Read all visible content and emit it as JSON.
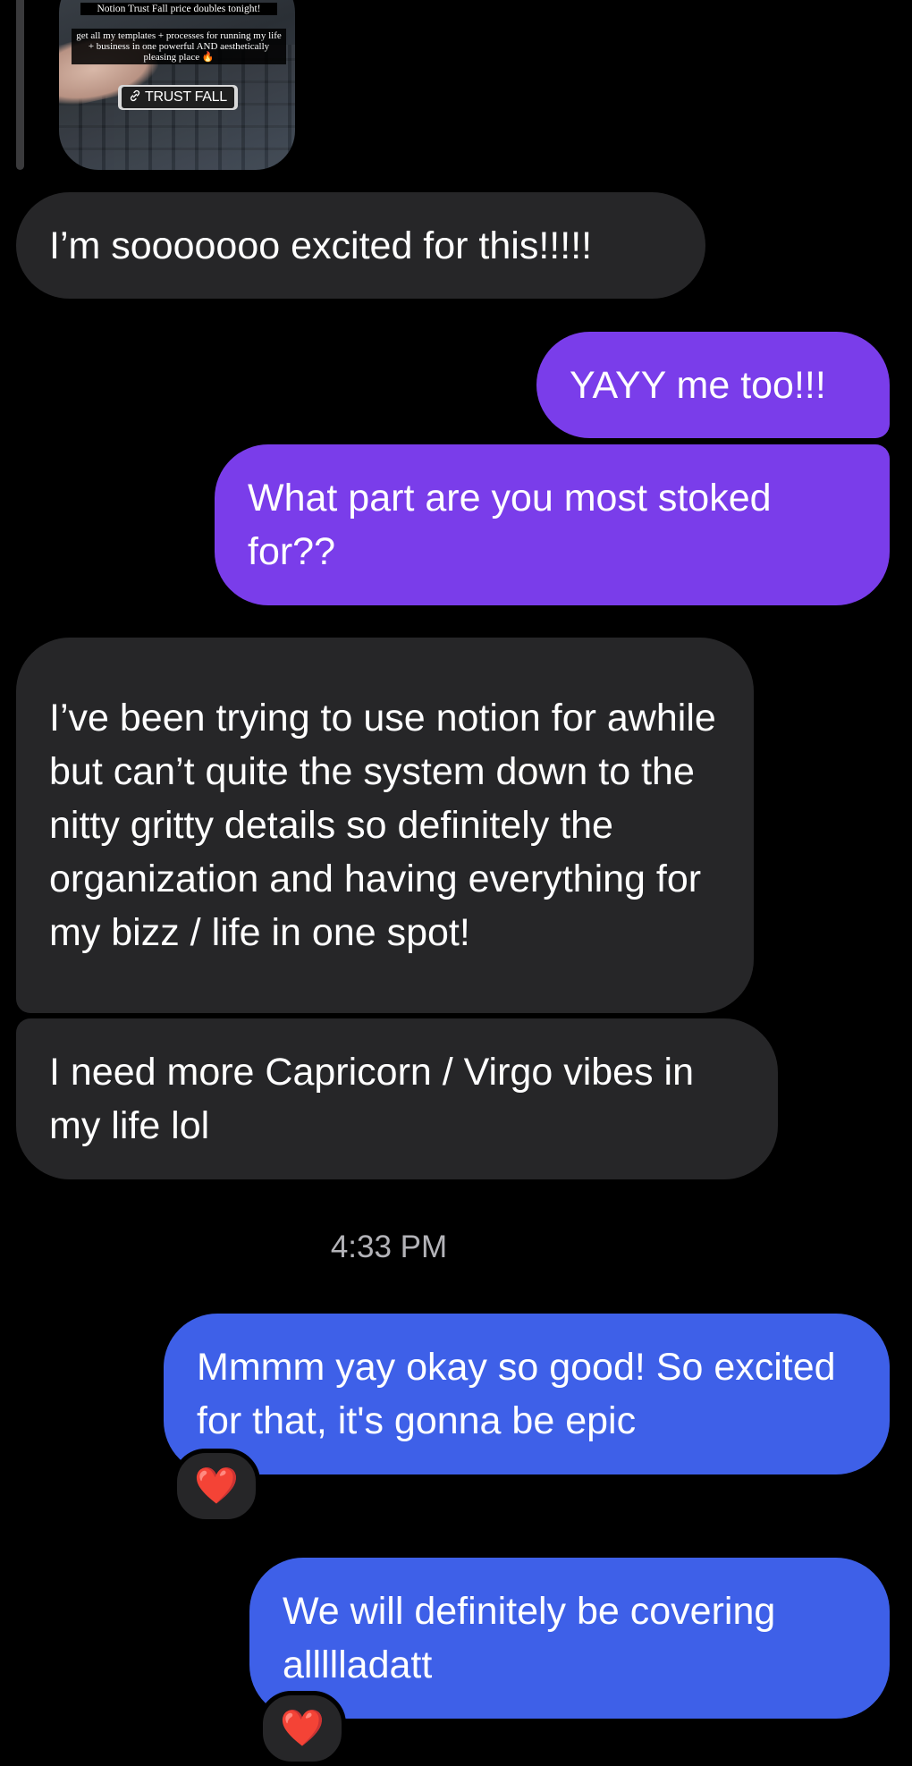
{
  "story_reply": {
    "caption_title": "Notion Trust Fall price doubles tonight!",
    "caption_body": "get all my templates + processes for running my life + business in one powerful AND aesthetically pleasing place 🔥",
    "link_label": "TRUST FALL",
    "link_icon": "link-icon"
  },
  "messages": [
    {
      "id": "m1",
      "direction": "received",
      "text": "I’m sooooooo excited for this!!!!!"
    },
    {
      "id": "m2",
      "direction": "sent",
      "text": "YAYY me too!!!"
    },
    {
      "id": "m3",
      "direction": "sent",
      "text": "What part are you most stoked for??"
    },
    {
      "id": "m4",
      "direction": "received",
      "text": "I’ve been trying to use notion for awhile but can’t quite the system down to the nitty gritty details so definitely the organization and having everything for my bizz / life in one spot!"
    },
    {
      "id": "m5",
      "direction": "received",
      "text": "I need more Capricorn / Virgo vibes in my life lol"
    },
    {
      "id": "m6",
      "direction": "sent",
      "text": "Mmmm yay okay so good! So excited for that, it's gonna be epic",
      "reaction": "❤️"
    },
    {
      "id": "m7",
      "direction": "sent",
      "text": "We will definitely be covering allllladatt",
      "reaction": "❤️"
    }
  ],
  "timestamp": "4:33 PM",
  "colors": {
    "background": "#000000",
    "received_bubble": "#262628",
    "sent_purple": "#7a3dea",
    "sent_blue": "#3e60e8",
    "timestamp_text": "#b3b3b8"
  }
}
